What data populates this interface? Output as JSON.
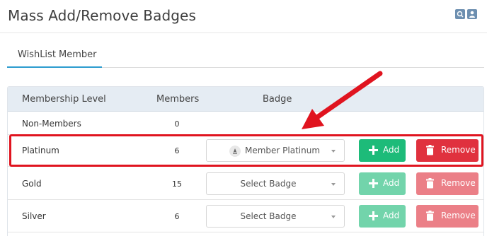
{
  "page": {
    "title": "Mass Add/Remove Badges"
  },
  "tabs": [
    {
      "label": "WishList Member"
    }
  ],
  "table": {
    "headers": {
      "level": "Membership Level",
      "members": "Members",
      "badge": "Badge"
    },
    "rows": [
      {
        "level": "Non-Members",
        "members": "0"
      },
      {
        "level": "Platinum",
        "members": "6",
        "badge": "Member Platinum",
        "add": "Add",
        "remove": "Remove"
      },
      {
        "level": "Gold",
        "members": "15",
        "badge": "Select Badge",
        "add": "Add",
        "remove": "Remove"
      },
      {
        "level": "Silver",
        "members": "6",
        "badge": "Select Badge",
        "add": "Add",
        "remove": "Remove"
      }
    ]
  },
  "colors": {
    "add": "#1dbb79",
    "remove": "#e0313e",
    "highlight": "#e0141f",
    "tab_underline": "#2d9ccf",
    "table_header": "#e5ecf3"
  },
  "icons": {
    "header": [
      "search-doc-icon",
      "user-doc-icon"
    ],
    "add": "plus-icon",
    "remove": "trash-icon",
    "badge": "badge-icon",
    "dropdown": "chevron-down-icon"
  }
}
